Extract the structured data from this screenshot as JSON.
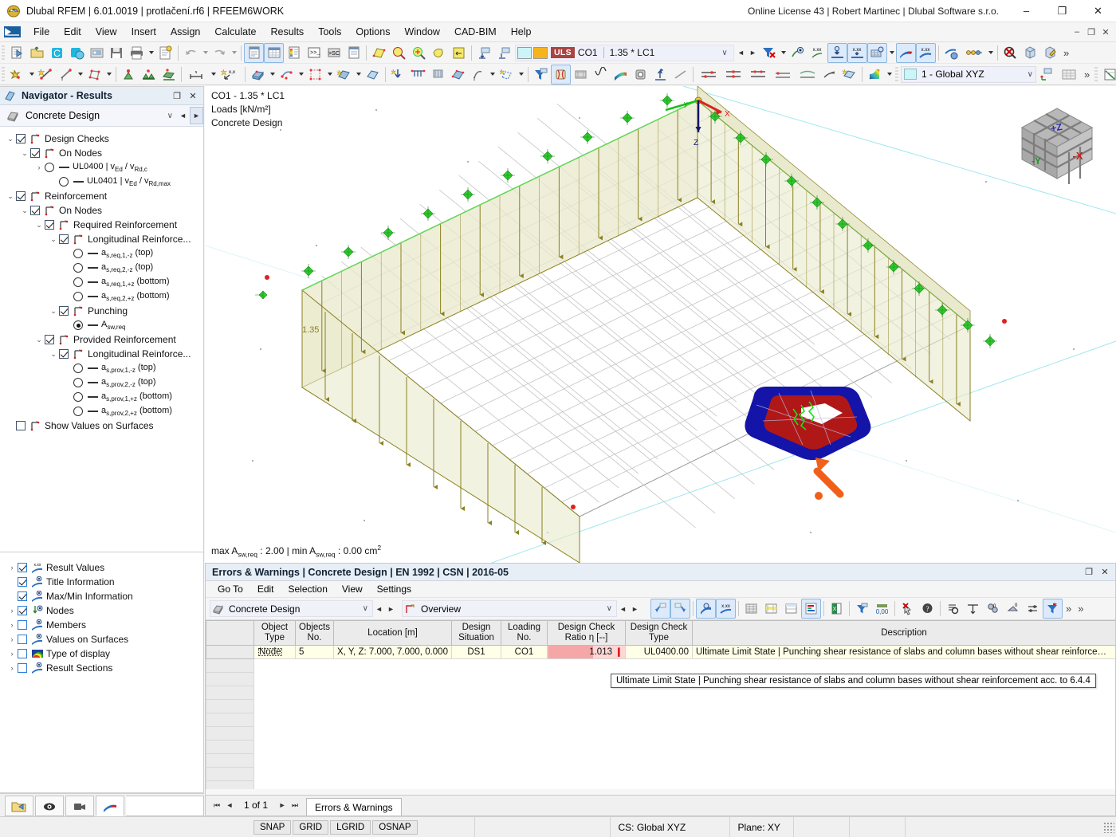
{
  "titlebar": {
    "app_title": "Dlubal RFEM | 6.01.0019 | protlačení.rf6 | RFEEM6WORK",
    "license": "Online License 43 | Robert Martinec | Dlubal Software s.r.o.",
    "minimize": "–",
    "maximize": "❐",
    "close": "✕"
  },
  "menu": {
    "items": [
      "File",
      "Edit",
      "View",
      "Insert",
      "Assign",
      "Calculate",
      "Results",
      "Tools",
      "Options",
      "Window",
      "CAD-BIM",
      "Help"
    ],
    "win_min": "–",
    "win_max": "❐",
    "win_close": "✕"
  },
  "toolbar": {
    "load_case": {
      "uls_badge": "ULS",
      "combination": "CO1",
      "formula": "1.35 * LC1",
      "chevron": "∨",
      "prev": "◄",
      "next": "►"
    },
    "coordinate_system": {
      "value": "1 - Global XYZ",
      "chevron": "∨"
    },
    "overflow": "»"
  },
  "navigator": {
    "title": "Navigator - Results",
    "restore": "❐",
    "close": "✕",
    "combo": {
      "value": "Concrete Design",
      "chevron": "∨",
      "prev": "◄",
      "next": "►"
    },
    "tree": [
      {
        "indent": 0,
        "twisty": "⌄",
        "check": "on",
        "icon": "result-node-icon",
        "label": "Design Checks",
        "type": "check"
      },
      {
        "indent": 1,
        "twisty": "⌄",
        "check": "on",
        "icon": "result-node-icon",
        "label": "On Nodes",
        "type": "check"
      },
      {
        "indent": 2,
        "twisty": "›",
        "radio": "off",
        "label": "UL0400 | v<sub>Ed</sub> / v<sub>Rd,c</sub>",
        "type": "radio"
      },
      {
        "indent": 3,
        "twisty": "",
        "radio": "off",
        "label": "UL0401 | v<sub>Ed</sub> / v<sub>Rd,max</sub>",
        "type": "radio"
      },
      {
        "indent": 0,
        "twisty": "⌄",
        "check": "on",
        "icon": "result-node-icon",
        "label": "Reinforcement",
        "type": "check"
      },
      {
        "indent": 1,
        "twisty": "⌄",
        "check": "on",
        "icon": "result-node-icon",
        "label": "On Nodes",
        "type": "check"
      },
      {
        "indent": 2,
        "twisty": "⌄",
        "check": "on",
        "icon": "result-node-icon",
        "label": "Required Reinforcement",
        "type": "check"
      },
      {
        "indent": 3,
        "twisty": "⌄",
        "check": "on",
        "icon": "result-node-icon",
        "label": "Longitudinal Reinforce...",
        "type": "check"
      },
      {
        "indent": 4,
        "twisty": "",
        "radio": "off",
        "label": "a<sub>s,req,1,-z</sub> (top)",
        "type": "radio"
      },
      {
        "indent": 4,
        "twisty": "",
        "radio": "off",
        "label": "a<sub>s,req,2,-z</sub> (top)",
        "type": "radio"
      },
      {
        "indent": 4,
        "twisty": "",
        "radio": "off",
        "label": "a<sub>s,req,1,+z</sub> (bottom)",
        "type": "radio"
      },
      {
        "indent": 4,
        "twisty": "",
        "radio": "off",
        "label": "a<sub>s,req,2,+z</sub> (bottom)",
        "type": "radio"
      },
      {
        "indent": 3,
        "twisty": "⌄",
        "check": "on",
        "icon": "result-node-icon",
        "label": "Punching",
        "type": "check"
      },
      {
        "indent": 4,
        "twisty": "",
        "radio": "on",
        "label": "A<sub>sw,req</sub>",
        "type": "radio"
      },
      {
        "indent": 2,
        "twisty": "⌄",
        "check": "on",
        "icon": "result-node-icon",
        "label": "Provided Reinforcement",
        "type": "check"
      },
      {
        "indent": 3,
        "twisty": "⌄",
        "check": "on",
        "icon": "result-node-icon",
        "label": "Longitudinal Reinforce...",
        "type": "check"
      },
      {
        "indent": 4,
        "twisty": "",
        "radio": "off",
        "label": "a<sub>s,prov,1,-z</sub> (top)",
        "type": "radio"
      },
      {
        "indent": 4,
        "twisty": "",
        "radio": "off",
        "label": "a<sub>s,prov,2,-z</sub> (top)",
        "type": "radio"
      },
      {
        "indent": 4,
        "twisty": "",
        "radio": "off",
        "label": "a<sub>s,prov,1,+z</sub> (bottom)",
        "type": "radio"
      },
      {
        "indent": 4,
        "twisty": "",
        "radio": "off",
        "label": "a<sub>s,prov,2,+z</sub> (bottom)",
        "type": "radio"
      },
      {
        "indent": 0,
        "twisty": "",
        "check": "off",
        "icon": "result-node-icon",
        "label": "Show Values on Surfaces",
        "type": "check"
      }
    ]
  },
  "display_tree": {
    "items": [
      {
        "twisty": "›",
        "check": "on",
        "icon": "xxx-values-icon",
        "label": "Result Values"
      },
      {
        "twisty": "",
        "check": "on",
        "icon": "eye-display-icon",
        "label": "Title Information"
      },
      {
        "twisty": "",
        "check": "on",
        "icon": "eye-display-icon",
        "label": "Max/Min Information"
      },
      {
        "twisty": "›",
        "check": "on",
        "icon": "node-display-icon",
        "label": "Nodes"
      },
      {
        "twisty": "›",
        "check": "off",
        "icon": "eye-display-icon",
        "label": "Members"
      },
      {
        "twisty": "›",
        "check": "off",
        "icon": "eye-display-icon",
        "label": "Values on Surfaces"
      },
      {
        "twisty": "›",
        "check": "off",
        "icon": "rainbow-icon",
        "label": "Type of display"
      },
      {
        "twisty": "›",
        "check": "off",
        "icon": "eye-display-icon",
        "label": "Result Sections"
      }
    ]
  },
  "view3d": {
    "title_line1": "CO1 - 1.35 * LC1",
    "title_line2": "Loads [kN/m²]",
    "title_line3": "Concrete Design",
    "load_label": "1.35",
    "minmax": "max A<sub>sw,req</sub> : 2.00 | min A<sub>sw,req</sub> : 0.00 cm<sup>2</sup>",
    "axis_global": {
      "x": "x",
      "y": "y",
      "z": "z"
    },
    "axis_origin": {
      "x": "X",
      "y": "y",
      "z": "Z"
    },
    "viewcube": {
      "z": "+Z",
      "y": "-Y",
      "x": "-X"
    }
  },
  "table_panel": {
    "title": "Errors & Warnings | Concrete Design | EN 1992 | CSN | 2016-05",
    "restore": "❐",
    "close": "✕",
    "menu": [
      "Go To",
      "Edit",
      "Selection",
      "View",
      "Settings"
    ],
    "combo_left": {
      "value": "Concrete Design",
      "chevron": "∨",
      "prev": "◄",
      "next": "►"
    },
    "combo_right": {
      "value": "Overview",
      "chevron": "∨",
      "prev": "◄",
      "next": "►"
    },
    "overflow": "»",
    "columns": [
      {
        "line1": "",
        "line2": ""
      },
      {
        "line1": "Object",
        "line2": "Type"
      },
      {
        "line1": "Objects",
        "line2": "No."
      },
      {
        "line1": "",
        "line2": "Location [m]"
      },
      {
        "line1": "Design",
        "line2": "Situation"
      },
      {
        "line1": "Loading",
        "line2": "No."
      },
      {
        "line1": "Design Check",
        "line2": "Ratio η [--]"
      },
      {
        "line1": "Design Check",
        "line2": "Type"
      },
      {
        "line1": "",
        "line2": "Description"
      }
    ],
    "rows": [
      {
        "index": "",
        "object_type": "Node",
        "objects_no": "5",
        "location": "X, Y, Z: 7.000, 7.000, 0.000",
        "design_situation": "DS1",
        "loading_no": "CO1",
        "ratio": "1.013",
        "ratio_flag": "❙",
        "design_check_type": "UL0400.00",
        "description": "Ultimate Limit State | Punching shear resistance of slabs and column bases without shear reinforcem..."
      }
    ],
    "tooltip": "Ultimate Limit State | Punching shear resistance of slabs and column bases without shear reinforcement acc. to 6.4.4",
    "pager": {
      "first": "⏮",
      "prev": "◄",
      "text": "1 of 1",
      "next": "►",
      "last": "⏭"
    },
    "sheet_tab": "Errors & Warnings"
  },
  "statusbar": {
    "snap_buttons": [
      "SNAP",
      "GRID",
      "LGRID",
      "OSNAP"
    ],
    "cs": "CS: Global XYZ",
    "plane": "Plane: XY"
  }
}
